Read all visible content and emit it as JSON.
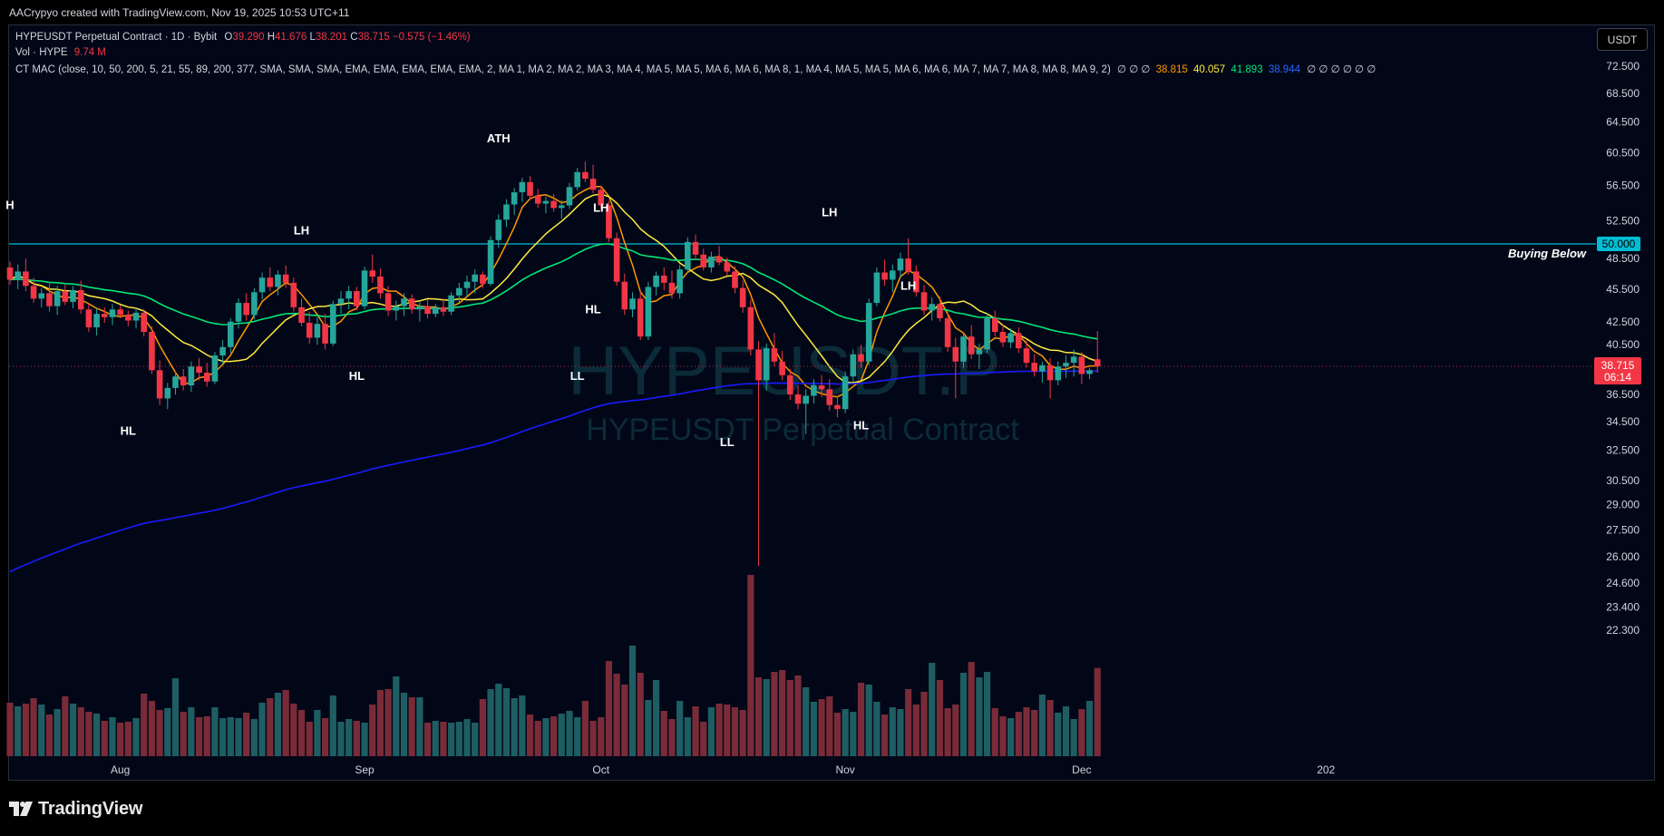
{
  "header": {
    "caption": "AACrypyo created with TradingView.com, Nov 19, 2025 10:53 UTC+11"
  },
  "footer": {
    "brand": "TradingView",
    "logo_icon": "tradingview-logo-icon"
  },
  "legend": {
    "symbol": "HYPEUSDT Perpetual Contract · 1D · Bybit",
    "o_label": "O",
    "o_value": "39.290",
    "h_label": "H",
    "h_value": "41.676",
    "l_label": "L",
    "l_value": "38.201",
    "c_label": "C",
    "c_value": "38.715",
    "change": "−0.575 (−1.46%)",
    "vol_label": "Vol · HYPE",
    "vol_value": "9.74 M",
    "mac_label": "CT MAC (close, 10, 50, 200, 5, 21, 55, 89, 200, 377, SMA, SMA, SMA, EMA, EMA, EMA, EMA, EMA, 2, MA 1, MA 2, MA 2, MA 3, MA 4, MA 5, MA 5, MA 6, MA 6, MA 8, 1, MA 4, MA 5, MA 5, MA 6, MA 6, MA 7, MA 7, MA 8, MA 8, MA 9, 2)",
    "mac_null_pre": "∅ ∅ ∅",
    "ma_values": [
      "38.815",
      "40.057",
      "41.893",
      "38.944"
    ],
    "mac_null_post": "∅ ∅ ∅ ∅ ∅ ∅",
    "currency_button": "USDT"
  },
  "watermark": {
    "line1": "HYPEUSDT.P",
    "line2": "HYPEUSDT Perpetual Contract"
  },
  "colors": {
    "up": "#26a69a",
    "down": "#f23645",
    "vol_up": "#1e5e63",
    "vol_down": "#7a2b38",
    "ma_orange": "#ff9800",
    "ma_yellow": "#ffeb3b",
    "ma_green": "#00e676",
    "ma_blue": "#1a1aff",
    "level_line": "#00bcd4",
    "background": "#020718"
  },
  "chart_data": {
    "type": "candlestick",
    "y_axis": {
      "scale": "log",
      "ticks": [
        "72.500",
        "68.500",
        "64.500",
        "60.500",
        "56.500",
        "52.500",
        "48.500",
        "45.500",
        "42.500",
        "40.500",
        "38.500",
        "36.500",
        "34.500",
        "32.500",
        "30.500",
        "29.000",
        "27.500",
        "26.000",
        "24.600",
        "23.400",
        "22.300"
      ]
    },
    "x_axis": {
      "ticks": [
        {
          "label": "Aug",
          "date": "2025-08-01"
        },
        {
          "label": "Sep",
          "date": "2025-09-01"
        },
        {
          "label": "Oct",
          "date": "2025-10-01"
        },
        {
          "label": "Nov",
          "date": "2025-11-01"
        },
        {
          "label": "Dec",
          "date": "2025-12-01"
        },
        {
          "label": "202",
          "date": "2026-01-01"
        }
      ],
      "range": [
        "2025-07-18",
        "2026-01-02"
      ]
    },
    "level": {
      "value": 50.0,
      "label": "50.000",
      "text": "Buying Below"
    },
    "last_price": {
      "value": 38.715,
      "label": "38.715",
      "countdown": "06:14"
    },
    "annotations": [
      {
        "text": "H",
        "date": "2025-07-18",
        "price": 54.2
      },
      {
        "text": "LH",
        "date": "2025-08-24",
        "price": 51.4
      },
      {
        "text": "HL",
        "date": "2025-08-02",
        "price": 33.8
      },
      {
        "text": "HL",
        "date": "2025-08-31",
        "price": 37.9
      },
      {
        "text": "ATH",
        "date": "2025-09-18",
        "price": 62.3
      },
      {
        "text": "LL",
        "date": "2025-09-28",
        "price": 37.9
      },
      {
        "text": "HL",
        "date": "2025-09-30",
        "price": 43.6
      },
      {
        "text": "LH",
        "date": "2025-10-01",
        "price": 53.9
      },
      {
        "text": "LL",
        "date": "2025-10-17",
        "price": 33.0
      },
      {
        "text": "LH",
        "date": "2025-10-30",
        "price": 53.4
      },
      {
        "text": "HL",
        "date": "2025-11-03",
        "price": 34.2
      },
      {
        "text": "LH",
        "date": "2025-11-09",
        "price": 45.8
      }
    ],
    "series": [
      {
        "name": "HYPEUSDT Perpetual Contract",
        "type": "candlestick",
        "ohlc": [
          [
            47.6,
            48.2,
            45.9,
            46.4
          ],
          [
            46.4,
            47.9,
            45.5,
            47.2
          ],
          [
            47.2,
            48.5,
            45.3,
            45.8
          ],
          [
            45.8,
            46.6,
            44.2,
            44.6
          ],
          [
            44.6,
            45.6,
            43.8,
            45.1
          ],
          [
            45.1,
            46.2,
            43.4,
            43.9
          ],
          [
            43.9,
            45.8,
            43.1,
            45.3
          ],
          [
            45.3,
            45.9,
            44.0,
            44.3
          ],
          [
            44.3,
            45.8,
            43.7,
            45.4
          ],
          [
            45.4,
            46.3,
            43.2,
            43.6
          ],
          [
            43.6,
            44.1,
            41.6,
            42.0
          ],
          [
            42.0,
            43.7,
            41.3,
            43.2
          ],
          [
            43.2,
            43.8,
            42.4,
            42.9
          ],
          [
            42.9,
            44.1,
            42.2,
            43.6
          ],
          [
            43.6,
            44.0,
            42.8,
            43.1
          ],
          [
            43.1,
            43.5,
            42.1,
            42.6
          ],
          [
            42.6,
            43.8,
            41.9,
            43.3
          ],
          [
            43.3,
            43.6,
            41.2,
            41.6
          ],
          [
            41.6,
            42.1,
            38.1,
            38.4
          ],
          [
            38.4,
            39.2,
            35.7,
            36.2
          ],
          [
            36.2,
            37.4,
            35.4,
            37.0
          ],
          [
            37.0,
            38.3,
            36.5,
            37.9
          ],
          [
            37.9,
            38.5,
            36.8,
            37.2
          ],
          [
            37.2,
            39.1,
            36.7,
            38.7
          ],
          [
            38.7,
            39.4,
            37.6,
            38.2
          ],
          [
            38.2,
            39.0,
            37.1,
            37.5
          ],
          [
            37.5,
            39.9,
            37.3,
            39.6
          ],
          [
            39.6,
            40.9,
            38.9,
            40.3
          ],
          [
            40.3,
            42.8,
            39.8,
            42.5
          ],
          [
            42.5,
            44.6,
            41.9,
            44.2
          ],
          [
            44.2,
            45.1,
            42.6,
            43.1
          ],
          [
            43.1,
            45.6,
            42.7,
            45.2
          ],
          [
            45.2,
            47.1,
            44.5,
            46.6
          ],
          [
            46.6,
            47.6,
            45.3,
            45.7
          ],
          [
            45.7,
            47.3,
            44.9,
            46.9
          ],
          [
            46.9,
            47.8,
            45.6,
            46.1
          ],
          [
            46.1,
            46.6,
            43.4,
            43.8
          ],
          [
            43.8,
            44.6,
            42.1,
            42.4
          ],
          [
            42.4,
            43.4,
            40.6,
            41.1
          ],
          [
            41.1,
            42.9,
            40.5,
            42.3
          ],
          [
            42.3,
            43.2,
            40.1,
            40.6
          ],
          [
            40.6,
            44.4,
            40.4,
            44.1
          ],
          [
            44.1,
            45.3,
            43.2,
            44.6
          ],
          [
            44.6,
            45.8,
            43.6,
            45.3
          ],
          [
            45.3,
            45.7,
            43.5,
            43.9
          ],
          [
            43.9,
            47.7,
            43.6,
            47.3
          ],
          [
            47.3,
            48.9,
            46.1,
            46.7
          ],
          [
            46.7,
            47.5,
            44.6,
            45.1
          ],
          [
            45.1,
            45.8,
            43.0,
            43.5
          ],
          [
            43.5,
            44.4,
            42.6,
            43.9
          ],
          [
            43.9,
            45.1,
            43.0,
            44.6
          ],
          [
            44.6,
            45.0,
            43.2,
            43.6
          ],
          [
            43.6,
            44.3,
            42.5,
            43.9
          ],
          [
            43.9,
            44.5,
            42.8,
            43.2
          ],
          [
            43.2,
            44.1,
            42.9,
            43.8
          ],
          [
            43.8,
            44.6,
            43.0,
            43.4
          ],
          [
            43.4,
            45.2,
            43.1,
            44.9
          ],
          [
            44.9,
            46.1,
            44.2,
            45.6
          ],
          [
            45.6,
            46.8,
            44.8,
            46.2
          ],
          [
            46.2,
            47.4,
            45.1,
            46.9
          ],
          [
            46.9,
            47.2,
            45.6,
            46.0
          ],
          [
            46.0,
            50.8,
            45.8,
            50.4
          ],
          [
            50.4,
            53.2,
            49.6,
            52.6
          ],
          [
            52.6,
            54.9,
            51.8,
            54.3
          ],
          [
            54.3,
            56.2,
            53.1,
            55.7
          ],
          [
            55.7,
            57.4,
            54.6,
            56.9
          ],
          [
            56.9,
            57.6,
            54.8,
            55.3
          ],
          [
            55.3,
            56.1,
            53.9,
            54.4
          ],
          [
            54.4,
            55.2,
            53.3,
            54.7
          ],
          [
            54.7,
            55.5,
            53.5,
            53.9
          ],
          [
            53.9,
            54.8,
            52.7,
            54.2
          ],
          [
            54.2,
            56.8,
            53.8,
            56.3
          ],
          [
            56.3,
            58.6,
            55.9,
            58.1
          ],
          [
            58.1,
            59.4,
            56.9,
            57.3
          ],
          [
            57.3,
            59.0,
            55.6,
            56.0
          ],
          [
            56.0,
            56.4,
            53.8,
            54.2
          ],
          [
            54.2,
            54.7,
            50.2,
            50.6
          ],
          [
            50.6,
            51.2,
            45.8,
            46.2
          ],
          [
            46.2,
            47.0,
            43.1,
            43.6
          ],
          [
            43.6,
            45.2,
            42.9,
            44.6
          ],
          [
            44.6,
            45.3,
            40.9,
            41.2
          ],
          [
            41.2,
            46.2,
            40.9,
            45.7
          ],
          [
            45.7,
            47.2,
            44.9,
            46.8
          ],
          [
            46.8,
            47.6,
            45.4,
            46.1
          ],
          [
            46.1,
            47.3,
            44.6,
            45.1
          ],
          [
            45.1,
            47.9,
            44.6,
            47.4
          ],
          [
            47.4,
            50.7,
            47.0,
            50.2
          ],
          [
            50.2,
            51.0,
            48.4,
            48.9
          ],
          [
            48.9,
            49.5,
            47.3,
            47.6
          ],
          [
            47.6,
            49.2,
            47.1,
            48.7
          ],
          [
            48.7,
            49.8,
            47.8,
            48.1
          ],
          [
            48.1,
            48.6,
            46.8,
            47.2
          ],
          [
            47.2,
            47.7,
            45.1,
            45.6
          ],
          [
            45.6,
            46.3,
            43.3,
            43.8
          ],
          [
            43.8,
            44.5,
            39.6,
            40.1
          ],
          [
            40.1,
            40.8,
            25.5,
            37.6
          ],
          [
            37.6,
            40.6,
            36.8,
            40.2
          ],
          [
            40.2,
            41.5,
            38.7,
            39.1
          ],
          [
            39.1,
            40.0,
            37.6,
            38.0
          ],
          [
            38.0,
            38.5,
            36.1,
            36.5
          ],
          [
            36.5,
            37.2,
            35.4,
            35.8
          ],
          [
            35.8,
            36.9,
            33.6,
            36.4
          ],
          [
            36.4,
            37.7,
            35.8,
            37.2
          ],
          [
            37.2,
            38.0,
            36.3,
            36.9
          ],
          [
            36.9,
            37.7,
            35.3,
            35.7
          ],
          [
            35.7,
            36.4,
            34.8,
            35.4
          ],
          [
            35.4,
            38.3,
            35.1,
            37.9
          ],
          [
            37.9,
            40.1,
            37.5,
            39.7
          ],
          [
            39.7,
            40.5,
            38.6,
            39.1
          ],
          [
            39.1,
            44.6,
            38.8,
            44.2
          ],
          [
            44.2,
            47.6,
            43.9,
            47.1
          ],
          [
            47.1,
            48.4,
            45.8,
            46.4
          ],
          [
            46.4,
            47.9,
            45.2,
            47.3
          ],
          [
            47.3,
            49.1,
            46.6,
            48.5
          ],
          [
            48.5,
            50.6,
            46.9,
            47.2
          ],
          [
            47.2,
            47.8,
            44.8,
            45.2
          ],
          [
            45.2,
            45.9,
            43.1,
            43.5
          ],
          [
            43.5,
            44.7,
            42.6,
            44.1
          ],
          [
            44.1,
            44.8,
            42.5,
            42.8
          ],
          [
            42.8,
            43.4,
            39.9,
            40.3
          ],
          [
            40.3,
            41.1,
            36.2,
            39.1
          ],
          [
            39.1,
            41.6,
            38.6,
            41.2
          ],
          [
            41.2,
            42.2,
            39.3,
            39.7
          ],
          [
            39.7,
            40.6,
            38.5,
            40.1
          ],
          [
            40.1,
            43.3,
            39.8,
            42.8
          ],
          [
            42.8,
            43.5,
            41.2,
            41.6
          ],
          [
            41.6,
            42.3,
            40.3,
            40.7
          ],
          [
            40.7,
            41.9,
            40.2,
            41.5
          ],
          [
            41.5,
            42.0,
            39.8,
            40.2
          ],
          [
            40.2,
            40.9,
            38.6,
            39.0
          ],
          [
            39.0,
            39.7,
            37.9,
            38.3
          ],
          [
            38.3,
            39.1,
            37.4,
            38.8
          ],
          [
            38.8,
            39.4,
            36.2,
            37.6
          ],
          [
            37.6,
            39.1,
            37.2,
            38.7
          ],
          [
            38.7,
            39.6,
            37.8,
            39.0
          ],
          [
            39.0,
            40.1,
            37.9,
            39.5
          ],
          [
            39.5,
            39.9,
            37.3,
            38.1
          ],
          [
            38.1,
            38.6,
            37.7,
            38.4
          ],
          [
            39.29,
            41.676,
            38.201,
            38.715
          ]
        ]
      },
      {
        "name": "Vol · HYPE",
        "type": "volume",
        "values": [
          5.9,
          5.5,
          5.8,
          6.4,
          5.7,
          4.6,
          5.2,
          6.6,
          5.8,
          5.4,
          4.9,
          4.7,
          3.9,
          4.3,
          3.7,
          3.8,
          4.2,
          6.9,
          6.1,
          5.1,
          5.3,
          8.6,
          4.9,
          5.4,
          4.3,
          4.4,
          5.4,
          4.2,
          4.3,
          4.2,
          4.8,
          4.1,
          5.9,
          6.4,
          7.0,
          7.3,
          5.8,
          5.1,
          3.8,
          5.1,
          4.2,
          6.7,
          3.8,
          4.1,
          3.9,
          3.7,
          5.7,
          7.3,
          7.4,
          8.8,
          7.0,
          6.5,
          6.5,
          3.7,
          3.9,
          3.8,
          3.7,
          3.8,
          4.1,
          3.7,
          6.3,
          7.4,
          8.0,
          7.5,
          6.4,
          6.7,
          4.6,
          3.9,
          4.2,
          4.4,
          4.7,
          5.0,
          4.3,
          6.1,
          3.9,
          4.3,
          10.5,
          9.1,
          7.9,
          12.2,
          9.2,
          6.2,
          8.4,
          5.0,
          4.1,
          6.1,
          4.3,
          5.5,
          3.8,
          5.4,
          5.8,
          5.7,
          5.4,
          5.1,
          20.0,
          8.7,
          8.5,
          9.3,
          9.5,
          8.4,
          8.9,
          7.6,
          6.0,
          6.3,
          6.6,
          4.8,
          5.2,
          4.9,
          8.1,
          7.9,
          6.0,
          4.6,
          5.4,
          5.2,
          7.4,
          5.7,
          7.1,
          10.3,
          8.4,
          5.3,
          5.7,
          9.2,
          10.4,
          8.7,
          9.3,
          5.3,
          4.4,
          4.2,
          4.9,
          5.4,
          5.1,
          6.8,
          6.2,
          4.8,
          5.5,
          4.1,
          5.2,
          6.1,
          9.74
        ]
      },
      {
        "name": "MA",
        "line": "ma_orange"
      },
      {
        "name": "MA",
        "line": "ma_yellow"
      },
      {
        "name": "MA",
        "line": "ma_green"
      },
      {
        "name": "MA",
        "line": "ma_blue"
      }
    ]
  }
}
